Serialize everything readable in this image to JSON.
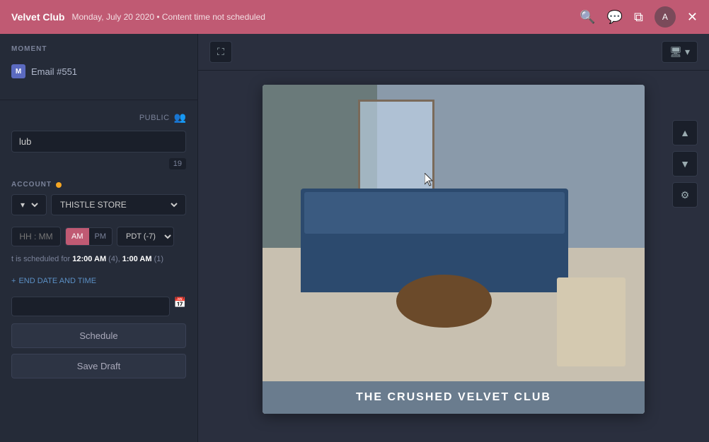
{
  "topbar": {
    "brand": "Velvet Club",
    "meta": "Monday, July 20 2020 • Content time not scheduled",
    "search_icon": "🔍",
    "chat_icon": "💬",
    "copy_icon": "⧉",
    "close_icon": "✕"
  },
  "sidebar": {
    "moment_label": "MOMENT",
    "moment_email": "Email #551",
    "public_label": "PUBLIC",
    "account_label": "ACCOUNT",
    "account_value": "THISTLE STORE",
    "time_placeholder": "HH : MM",
    "am_label": "AM",
    "pm_label": "PM",
    "timezone_value": "PDT (-7)",
    "schedule_note_prefix": "t is scheduled for",
    "schedule_time1": "12:00 AM",
    "schedule_count1": "(4),",
    "schedule_time2": "1:00 AM",
    "schedule_count2": "(1)",
    "end_date_label": "END DATE AND TIME",
    "count_badge": "19"
  },
  "preview": {
    "expand_icon": "⛶",
    "monitor_icon": "🖥",
    "settings_icon": "⚙",
    "up_icon": "▲",
    "down_icon": "▼",
    "email_caption": "THE CRUSHED VELVET CLUB"
  }
}
